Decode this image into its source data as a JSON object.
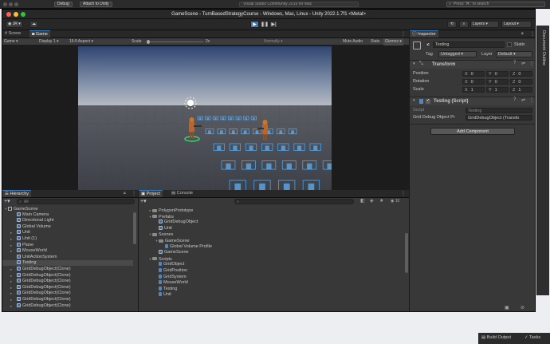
{
  "vs_top": {
    "debug_label": "Debug",
    "attach_label": "Attach to Unity",
    "solution_label": "Visual Studio Community 2019 for Mac",
    "search_placeholder": "Press '⌘.' to search"
  },
  "window_title": "GameScene - TurnBasedStrategyCourse - Windows, Mac, Linux - Unity 2022.1.7f1 <Metal>",
  "toolbar": {
    "account": "JR",
    "layers": "Layers",
    "layout": "Layout"
  },
  "scene_tabs": [
    "Scene",
    "Game"
  ],
  "game_bar": {
    "mode": "Game",
    "display": "Display 1",
    "aspect": "16:9 Aspect",
    "scale_label": "Scale",
    "scale_value": "2x",
    "normally": "Normally",
    "mute": "Mute Audio",
    "stats": "Stats",
    "gizmos": "Gizmos"
  },
  "hierarchy": {
    "tab": "Hierarchy",
    "search_placeholder": "All",
    "scene": "GameScene",
    "items": [
      "Main Camera",
      "Directional Light",
      "Global Volume",
      "Unit",
      "Unit (1)",
      "Plane",
      "MouseWorld",
      "UnitActionSystem",
      "Testing",
      "GridDebugObject(Clone)",
      "GridDebugObject(Clone)",
      "GridDebugObject(Clone)",
      "GridDebugObject(Clone)",
      "GridDebugObject(Clone)",
      "GridDebugObject(Clone)",
      "GridDebugObject(Clone)"
    ],
    "selected_index": 8
  },
  "project": {
    "tabs": [
      "Project",
      "Console"
    ],
    "count": "10",
    "items": [
      {
        "label": "PolygonPrototype",
        "depth": 1,
        "kind": "folder"
      },
      {
        "label": "Prefabs",
        "depth": 1,
        "kind": "folder"
      },
      {
        "label": "GridDebugObject",
        "depth": 2,
        "kind": "cube"
      },
      {
        "label": "Unit",
        "depth": 2,
        "kind": "cube"
      },
      {
        "label": "Scenes",
        "depth": 1,
        "kind": "folder"
      },
      {
        "label": "GameScene",
        "depth": 2,
        "kind": "folder"
      },
      {
        "label": "Global Volume Profile",
        "depth": 3,
        "kind": "file"
      },
      {
        "label": "GameScene",
        "depth": 2,
        "kind": "cube"
      },
      {
        "label": "Scripts",
        "depth": 1,
        "kind": "folder"
      },
      {
        "label": "GridObject",
        "depth": 2,
        "kind": "script"
      },
      {
        "label": "GridPosition",
        "depth": 2,
        "kind": "script"
      },
      {
        "label": "GridSystem",
        "depth": 2,
        "kind": "script"
      },
      {
        "label": "MouseWorld",
        "depth": 2,
        "kind": "script"
      },
      {
        "label": "Testing",
        "depth": 2,
        "kind": "script"
      },
      {
        "label": "Unit",
        "depth": 2,
        "kind": "script"
      }
    ]
  },
  "inspector": {
    "tab": "Inspector",
    "object_name": "Testing",
    "static_label": "Static",
    "tag_label": "Tag",
    "tag_value": "Untagged",
    "layer_label": "Layer",
    "layer_value": "Default",
    "transform": {
      "title": "Transform",
      "rows": [
        {
          "label": "Position",
          "x": "0",
          "y": "0",
          "z": "0"
        },
        {
          "label": "Rotation",
          "x": "0",
          "y": "0",
          "z": "0"
        },
        {
          "label": "Scale",
          "x": "1",
          "y": "1",
          "z": "1"
        }
      ]
    },
    "script_component": {
      "title": "Testing (Script)",
      "script_label": "Script",
      "script_value": "Testing",
      "field_label": "Grid Debug Object Pr",
      "field_value": "GridDebugObject (Transfo"
    },
    "add_component": "Add Component"
  },
  "side_tab": "Document Outline",
  "vs_status": {
    "build_output": "Build Output",
    "tasks": "Tasks"
  },
  "colors": {
    "accent": "#3a79bb",
    "selected_row": "#2c5d87",
    "panel_bg": "#383838"
  }
}
